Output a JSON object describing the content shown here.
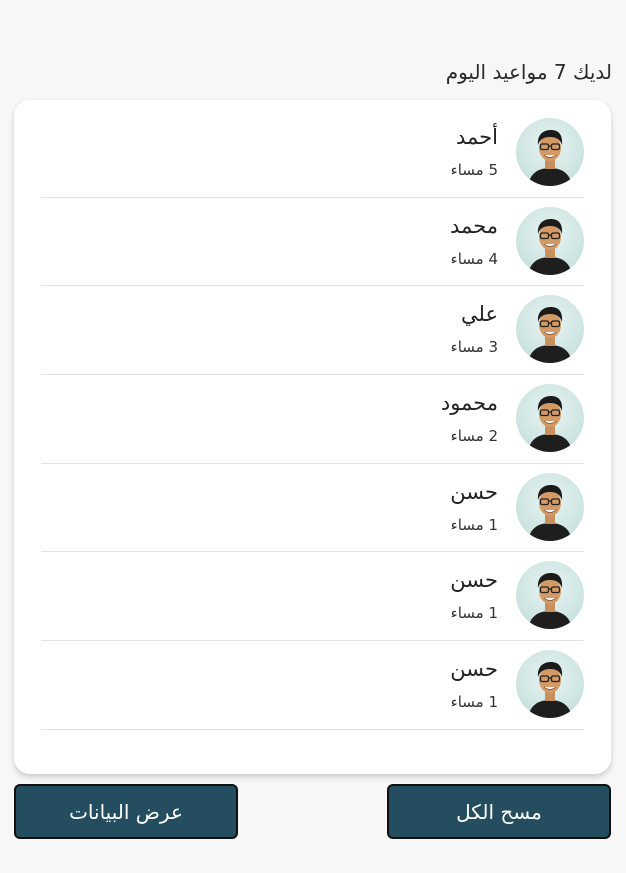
{
  "header": {
    "title": "لديك 7 مواعيد اليوم"
  },
  "appointments": [
    {
      "name": "أحمد",
      "time": "5 مساء"
    },
    {
      "name": "محمد",
      "time": "4 مساء"
    },
    {
      "name": "علي",
      "time": "3 مساء"
    },
    {
      "name": "محمود",
      "time": "2 مساء"
    },
    {
      "name": "حسن",
      "time": "1 مساء"
    },
    {
      "name": "حسن",
      "time": "1 مساء"
    },
    {
      "name": "حسن",
      "time": "1 مساء"
    }
  ],
  "actions": {
    "clear_all_label": "مسح الكل",
    "view_data_label": "عرض البيانات"
  },
  "colors": {
    "button_bg": "#244e5f",
    "page_bg": "#f7f7f7"
  },
  "icons": {
    "avatar": "user-avatar-icon"
  }
}
